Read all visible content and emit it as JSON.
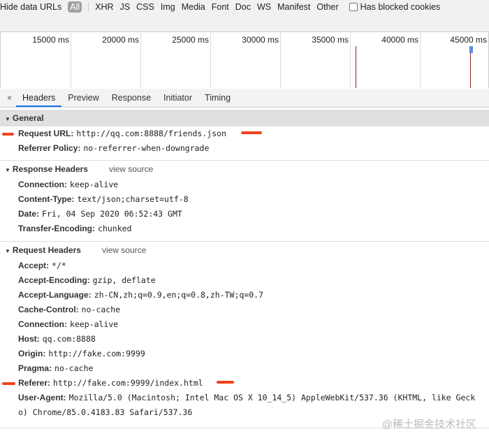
{
  "filter": {
    "hide_data_urls": "Hide data URLs",
    "types": [
      "All",
      "XHR",
      "JS",
      "CSS",
      "Img",
      "Media",
      "Font",
      "Doc",
      "WS",
      "Manifest",
      "Other"
    ],
    "blocked_cookies": "Has blocked cookies"
  },
  "timeline": {
    "ticks": [
      "15000 ms",
      "20000 ms",
      "25000 ms",
      "30000 ms",
      "35000 ms",
      "40000 ms",
      "45000 ms"
    ]
  },
  "tabs": {
    "close": "×",
    "items": [
      "Headers",
      "Preview",
      "Response",
      "Initiator",
      "Timing"
    ]
  },
  "general": {
    "title": "General",
    "rows": [
      {
        "k": "Request URL:",
        "v": "http://qq.com:8888/friends.json"
      },
      {
        "k": "Referrer Policy:",
        "v": "no-referrer-when-downgrade"
      }
    ]
  },
  "response": {
    "title": "Response Headers",
    "view_source": "view source",
    "rows": [
      {
        "k": "Connection:",
        "v": "keep-alive"
      },
      {
        "k": "Content-Type:",
        "v": "text/json;charset=utf-8"
      },
      {
        "k": "Date:",
        "v": "Fri, 04 Sep 2020 06:52:43 GMT"
      },
      {
        "k": "Transfer-Encoding:",
        "v": "chunked"
      }
    ]
  },
  "request": {
    "title": "Request Headers",
    "view_source": "view source",
    "rows": [
      {
        "k": "Accept:",
        "v": "*/*"
      },
      {
        "k": "Accept-Encoding:",
        "v": "gzip, deflate"
      },
      {
        "k": "Accept-Language:",
        "v": "zh-CN,zh;q=0.9,en;q=0.8,zh-TW;q=0.7"
      },
      {
        "k": "Cache-Control:",
        "v": "no-cache"
      },
      {
        "k": "Connection:",
        "v": "keep-alive"
      },
      {
        "k": "Host:",
        "v": "qq.com:8888"
      },
      {
        "k": "Origin:",
        "v": "http://fake.com:9999"
      },
      {
        "k": "Pragma:",
        "v": "no-cache"
      },
      {
        "k": "Referer:",
        "v": "http://fake.com:9999/index.html"
      },
      {
        "k": "User-Agent:",
        "v": "Mozilla/5.0 (Macintosh; Intel Mac OS X 10_14_5) AppleWebKit/537.36 (KHTML, like Gecko) Chrome/85.0.4183.83 Safari/537.36"
      }
    ]
  },
  "watermark": "@稀土掘金技术社区"
}
